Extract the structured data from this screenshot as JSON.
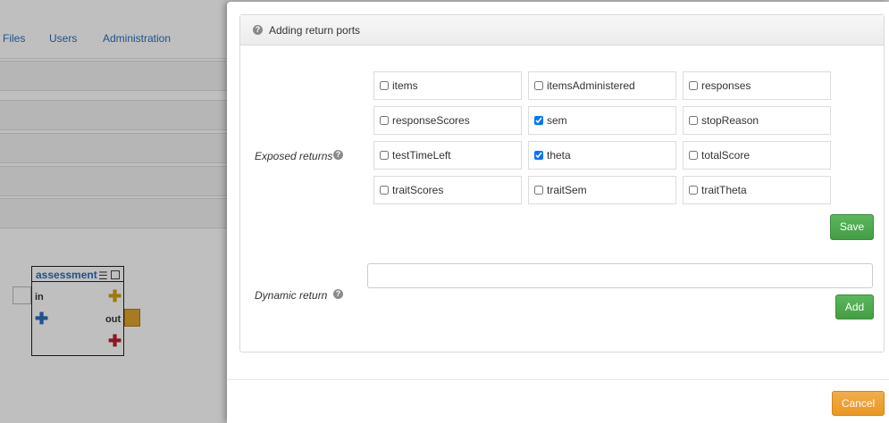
{
  "background": {
    "nav": [
      {
        "label": "Files"
      },
      {
        "label": "Users"
      },
      {
        "label": "Administration"
      }
    ],
    "node": {
      "title": "assessment",
      "menu_icon": "hamburger-icon",
      "in_label": "in",
      "out_label": "out",
      "plus_colors": {
        "yellow": "#d4a017",
        "blue": "#2a6ebb",
        "red": "#b8202e"
      }
    }
  },
  "modal": {
    "panel_title": "Adding return ports",
    "exposed_returns": {
      "label": "Exposed returns",
      "options": [
        {
          "label": "items",
          "checked": false
        },
        {
          "label": "itemsAdministered",
          "checked": false
        },
        {
          "label": "responses",
          "checked": false
        },
        {
          "label": "responseScores",
          "checked": false
        },
        {
          "label": "sem",
          "checked": true
        },
        {
          "label": "stopReason",
          "checked": false
        },
        {
          "label": "testTimeLeft",
          "checked": false
        },
        {
          "label": "theta",
          "checked": true
        },
        {
          "label": "totalScore",
          "checked": false
        },
        {
          "label": "traitScores",
          "checked": false
        },
        {
          "label": "traitSem",
          "checked": false
        },
        {
          "label": "traitTheta",
          "checked": false
        }
      ],
      "save_label": "Save"
    },
    "dynamic_return": {
      "label": "Dynamic return",
      "value": "",
      "placeholder": "",
      "add_label": "Add"
    },
    "cancel_label": "Cancel",
    "colors": {
      "save": "#5cb85c",
      "cancel": "#f0ad4e"
    }
  }
}
